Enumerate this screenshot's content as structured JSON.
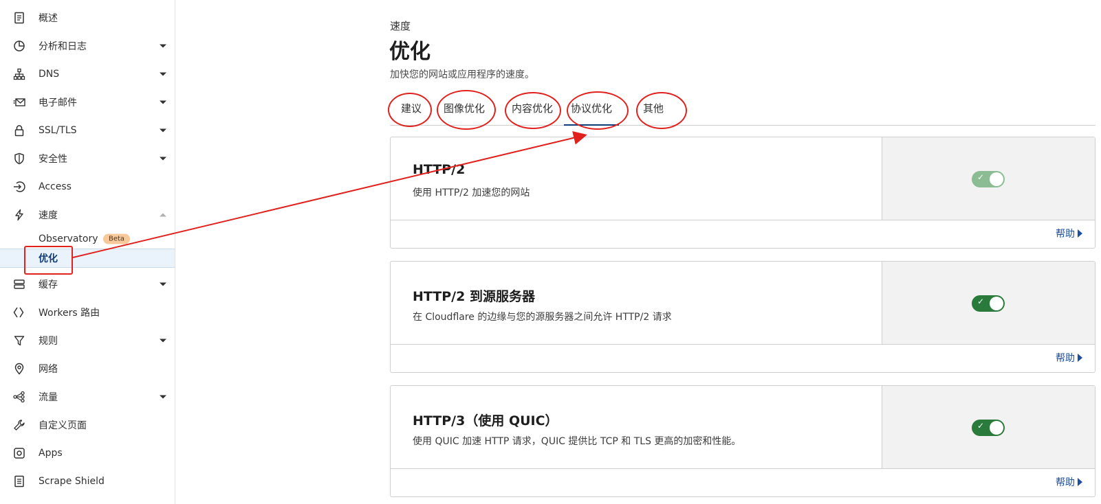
{
  "sidebar": {
    "items": [
      {
        "label": "概述",
        "icon": "document-icon",
        "caret": false
      },
      {
        "label": "分析和日志",
        "icon": "pie-chart-icon",
        "caret": true
      },
      {
        "label": "DNS",
        "icon": "network-icon",
        "caret": true
      },
      {
        "label": "电子邮件",
        "icon": "email-icon",
        "caret": true
      },
      {
        "label": "SSL/TLS",
        "icon": "lock-icon",
        "caret": true
      },
      {
        "label": "安全性",
        "icon": "shield-icon",
        "caret": true
      },
      {
        "label": "Access",
        "icon": "access-icon",
        "caret": false
      },
      {
        "label": "速度",
        "icon": "lightning-icon",
        "caret": "up"
      },
      {
        "label": "缓存",
        "icon": "storage-icon",
        "caret": true
      },
      {
        "label": "Workers 路由",
        "icon": "workers-icon",
        "caret": false
      },
      {
        "label": "规则",
        "icon": "funnel-icon",
        "caret": true
      },
      {
        "label": "网络",
        "icon": "location-pin-icon",
        "caret": false
      },
      {
        "label": "流量",
        "icon": "traffic-icon",
        "caret": true
      },
      {
        "label": "自定义页面",
        "icon": "wrench-icon",
        "caret": false
      },
      {
        "label": "Apps",
        "icon": "apps-icon",
        "caret": false
      },
      {
        "label": "Scrape Shield",
        "icon": "scrape-shield-icon",
        "caret": false
      }
    ],
    "speed_sub": {
      "observatory": "Observatory",
      "beta": "Beta",
      "optimization": "优化"
    }
  },
  "main": {
    "breadcrumb": "速度",
    "title": "优化",
    "description": "加快您的网站或应用程序的速度。",
    "tabs": [
      "建议",
      "图像优化",
      "内容优化",
      "协议优化",
      "其他"
    ],
    "active_tab": "协议优化"
  },
  "cards": [
    {
      "title": "HTTP/2",
      "description": "使用 HTTP/2 加速您的网站",
      "enabled": true,
      "disabled": true,
      "help": "帮助"
    },
    {
      "title": "HTTP/2 到源服务器",
      "description": "在 Cloudflare 的边缘与您的源服务器之间允许 HTTP/2 请求",
      "enabled": true,
      "disabled": false,
      "help": "帮助"
    },
    {
      "title": "HTTP/3（使用 QUIC）",
      "description": "使用 QUIC 加速 HTTP 请求，QUIC 提供比 TCP 和 TLS 更高的加密和性能。",
      "enabled": true,
      "disabled": false,
      "help": "帮助"
    }
  ],
  "colors": {
    "accent": "#0f3d7a",
    "toggle_on": "#2a7a3b",
    "annotation": "#e1211d",
    "link": "#1d4fa0"
  }
}
